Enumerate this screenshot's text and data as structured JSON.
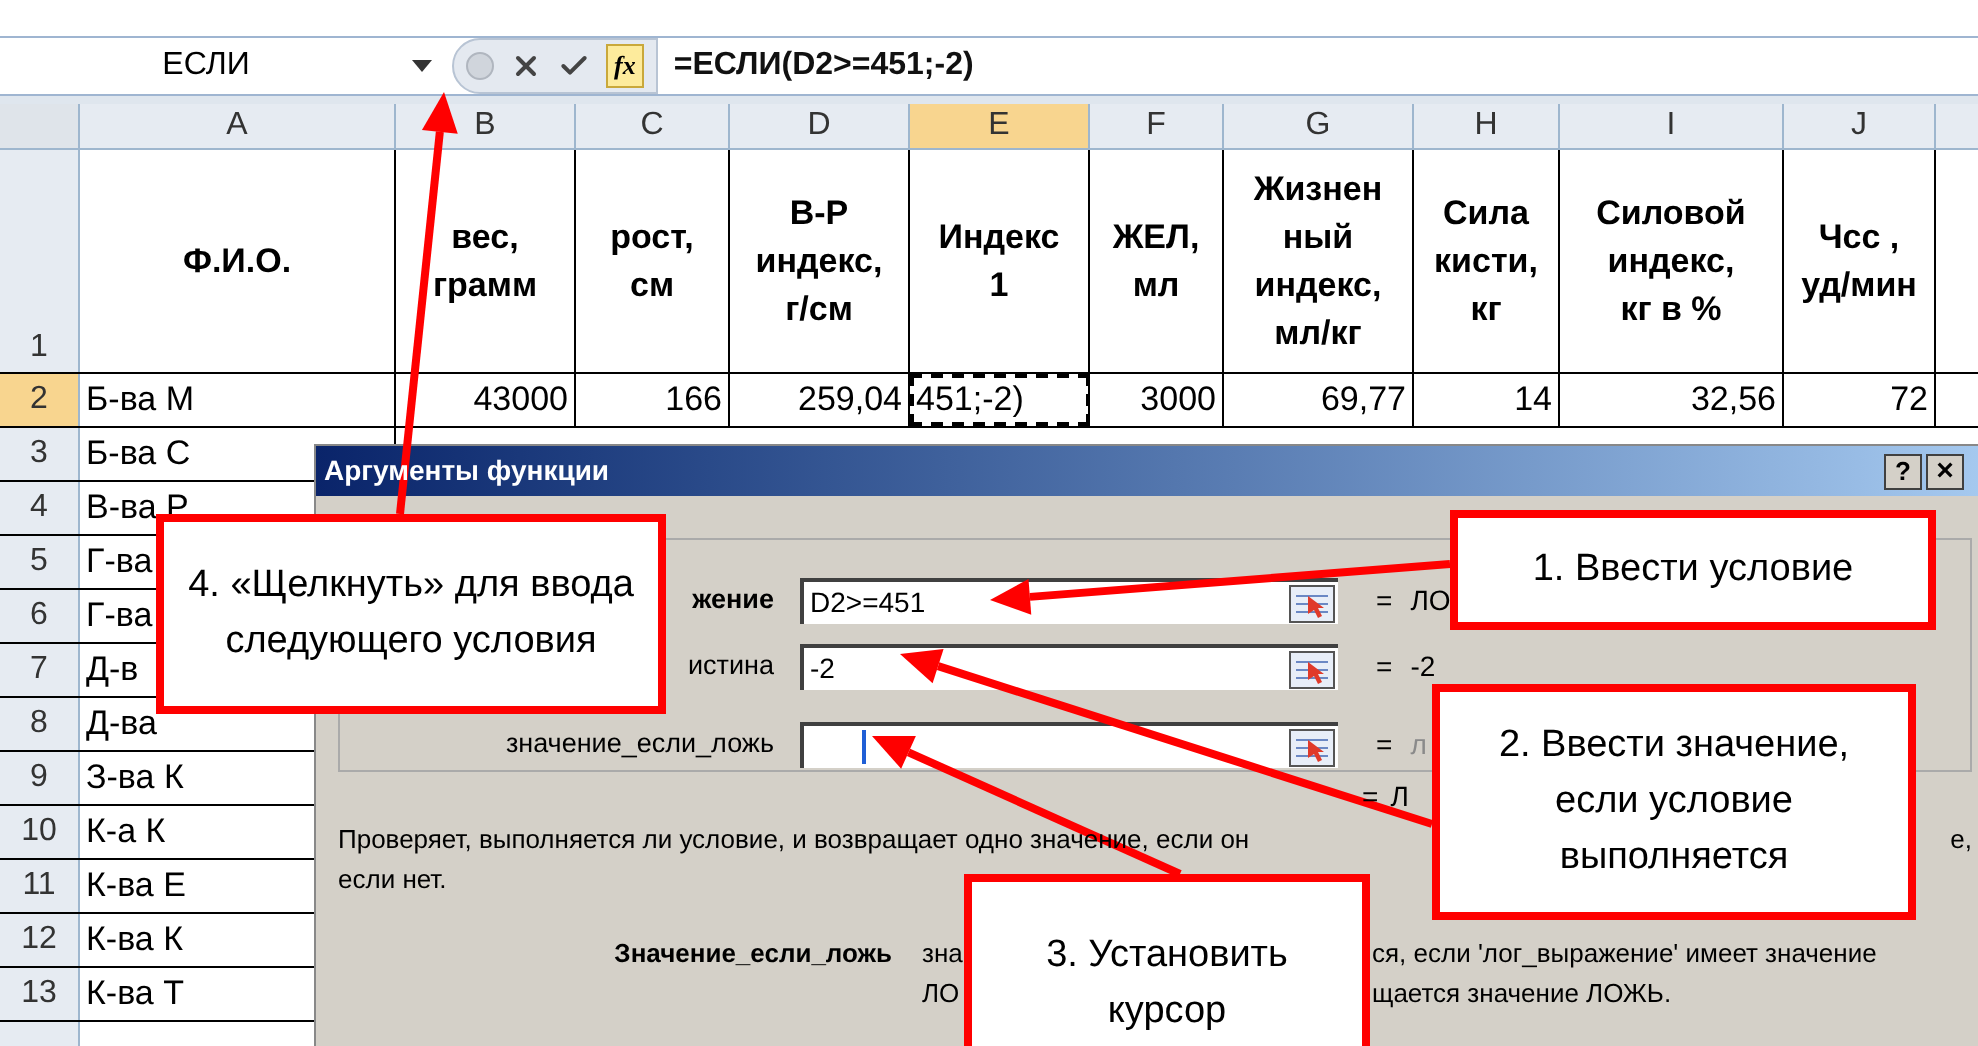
{
  "formula_bar": {
    "name_box": "ЕСЛИ",
    "fx_label": "fx",
    "formula": "=ЕСЛИ(D2>=451;-2)"
  },
  "columns": [
    {
      "letter": "A",
      "selected": false
    },
    {
      "letter": "B",
      "selected": false
    },
    {
      "letter": "C",
      "selected": false
    },
    {
      "letter": "D",
      "selected": false
    },
    {
      "letter": "E",
      "selected": true
    },
    {
      "letter": "F",
      "selected": false
    },
    {
      "letter": "G",
      "selected": false
    },
    {
      "letter": "H",
      "selected": false
    },
    {
      "letter": "I",
      "selected": false
    },
    {
      "letter": "J",
      "selected": false
    }
  ],
  "header_row": {
    "number": "1",
    "cells": [
      "Ф.И.О.",
      "вес, грамм",
      "рост, см",
      "В-Р индекс, г/см",
      "Индекс 1",
      "ЖЕЛ, мл",
      "Жизнен ный индекс, мл/кг",
      "Сила кисти, кг",
      "Силовой индекс, кг в %",
      "Чсс , уд/мин"
    ]
  },
  "rows": [
    {
      "number": "2",
      "selected": true,
      "cells": [
        "Б-ва М",
        "43000",
        "166",
        "259,04",
        "451;-2)",
        "3000",
        "69,77",
        "14",
        "32,56",
        "72"
      ]
    },
    {
      "number": "3",
      "selected": false,
      "cells": [
        "Б-ва С"
      ]
    },
    {
      "number": "4",
      "selected": false,
      "cells": [
        "В-ва Р"
      ]
    },
    {
      "number": "5",
      "selected": false,
      "cells": [
        "Г-ва"
      ]
    },
    {
      "number": "6",
      "selected": false,
      "cells": [
        "Г-ва"
      ]
    },
    {
      "number": "7",
      "selected": false,
      "cells": [
        "Д-в"
      ]
    },
    {
      "number": "8",
      "selected": false,
      "cells": [
        "Д-ва"
      ]
    },
    {
      "number": "9",
      "selected": false,
      "cells": [
        "З-ва К"
      ]
    },
    {
      "number": "10",
      "selected": false,
      "cells": [
        "К-а К"
      ]
    },
    {
      "number": "11",
      "selected": false,
      "cells": [
        "К-ва Е"
      ]
    },
    {
      "number": "12",
      "selected": false,
      "cells": [
        "К-ва К"
      ]
    },
    {
      "number": "13",
      "selected": false,
      "cells": [
        "К-ва Т"
      ]
    }
  ],
  "dialog": {
    "title": "Аргументы функции",
    "help_button": "?",
    "close_button": "×",
    "arguments": [
      {
        "label": "жение",
        "required": true,
        "value": "D2>=451",
        "focused": false,
        "result": "ЛО",
        "result_dimmed": false
      },
      {
        "label": "истина",
        "required": false,
        "value": "-2",
        "focused": false,
        "result": "-2",
        "result_dimmed": false
      },
      {
        "label": "значение_если_ложь",
        "required": false,
        "focused": true,
        "result": "л",
        "result_dimmed": true
      }
    ],
    "equals": "=",
    "result_line": "Л",
    "description_start": "Проверяет, выполняется ли условие, и возвращает одно значение, если он",
    "description_end": "е,",
    "description_line2": "если нет.",
    "argument_name": "Значение_если_ложь",
    "argument_help_left": [
      "зна",
      "ЛО"
    ],
    "argument_help_right": [
      "ся, если 'лог_выражение' имеет значение",
      "щается значение ЛОЖЬ."
    ]
  },
  "callouts": [
    {
      "text": "4. «Щелкнуть» для ввода следующего условия"
    },
    {
      "text": "1. Ввести условие"
    },
    {
      "text": "2. Ввести значение, если условие выполняется"
    },
    {
      "text": "3. Установить курсор"
    }
  ]
}
